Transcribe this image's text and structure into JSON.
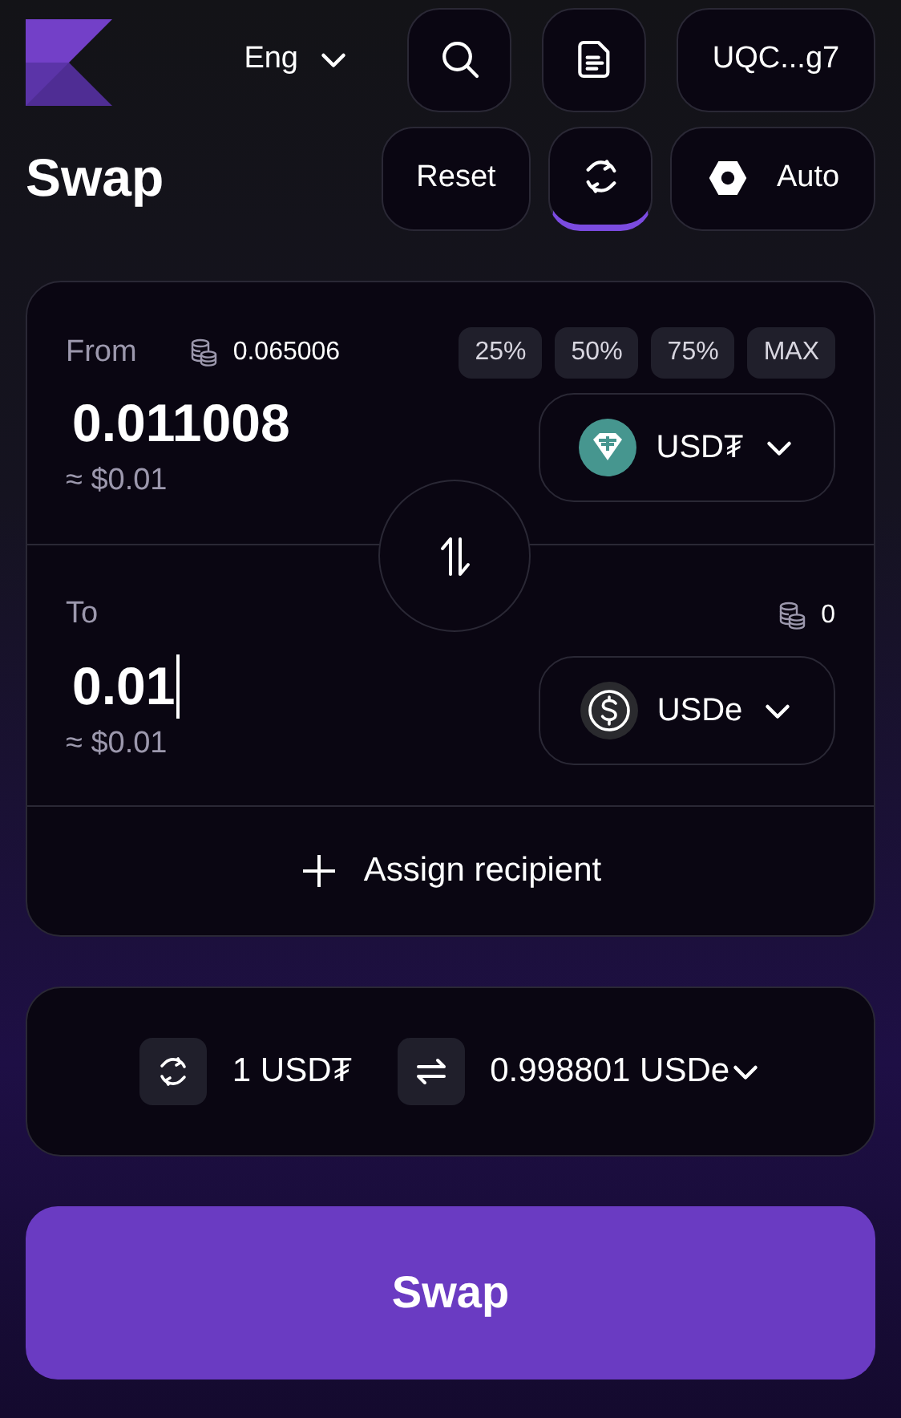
{
  "header": {
    "language": "Eng",
    "wallet": "UQC...g7"
  },
  "title": "Swap",
  "toolbar": {
    "reset": "Reset",
    "mode": "Auto"
  },
  "from": {
    "label": "From",
    "balance": "0.065006",
    "percent_buttons": [
      "25%",
      "50%",
      "75%",
      "MAX"
    ],
    "amount": "0.011008",
    "usd": "≈ $0.01",
    "token": {
      "symbol": "USD₮",
      "kind": "tether"
    },
    "focused": false
  },
  "to": {
    "label": "To",
    "balance": "0",
    "amount": "0.01",
    "usd": "≈ $0.01",
    "token": {
      "symbol": "USDe",
      "kind": "usde"
    },
    "focused": true
  },
  "recipient": "Assign recipient",
  "rate": {
    "from": "1 USD₮",
    "to": "0.998801 USDe"
  },
  "swap_button": "Swap"
}
